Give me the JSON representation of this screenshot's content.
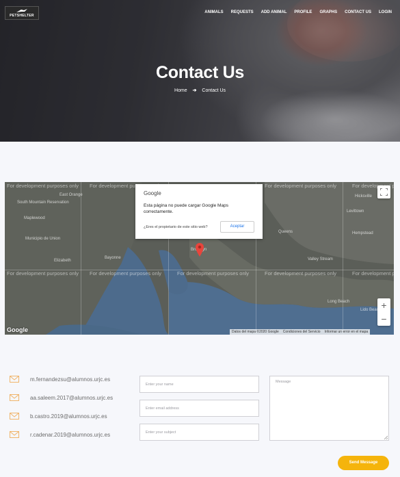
{
  "brand": {
    "logo_text": "PETSHELTER"
  },
  "nav": {
    "items": [
      "ANIMALS",
      "REQUESTS",
      "ADD ANIMAL",
      "PROFILE",
      "GRAPHS",
      "CONTACT US",
      "LOGIN"
    ]
  },
  "hero": {
    "title": "Contact Us",
    "breadcrumb_home": "Home",
    "breadcrumb_current": "Contact Us"
  },
  "map": {
    "watermark": "For development purposes only",
    "dialog_brand": "Google",
    "dialog_message": "Esta página no puede cargar Google Maps correctamente.",
    "dialog_question": "¿Eres el propietario de este sitio web?",
    "dialog_button": "Aceptar",
    "google_logo": "Google",
    "attribution_data": "Datos del mapa ©2020 Google",
    "attribution_terms": "Condiciones del Servicio",
    "attribution_report": "Informar un error en el mapa",
    "zoom_in": "+",
    "zoom_out": "−",
    "labels": [
      "East Orange",
      "South Mountain Reservation",
      "Maplewood",
      "Municipio de Union",
      "Elizabeth",
      "Bayonne",
      "Brooklyn",
      "Queens",
      "Hempstead",
      "Valley Stream",
      "Long Beach",
      "Lido Beach",
      "Hicksville",
      "Levittown"
    ]
  },
  "contact": {
    "emails": [
      "m.fernandezsu@alumnos.urjc.es",
      "aa.saleem.2017@alumnos.urjc.es",
      "b.castro.2019@alumnos.urjc.es",
      "r.cadenar.2019@alumnos.urjc.es"
    ],
    "name_placeholder": "Enter your name",
    "email_placeholder": "Enter email address",
    "subject_placeholder": "Enter your subject",
    "message_placeholder": "Message",
    "send_label": "Send Message"
  },
  "colors": {
    "accent": "#f5b40c",
    "mail_icon": "#f0b46a",
    "page_bg": "#f6f7fb"
  }
}
